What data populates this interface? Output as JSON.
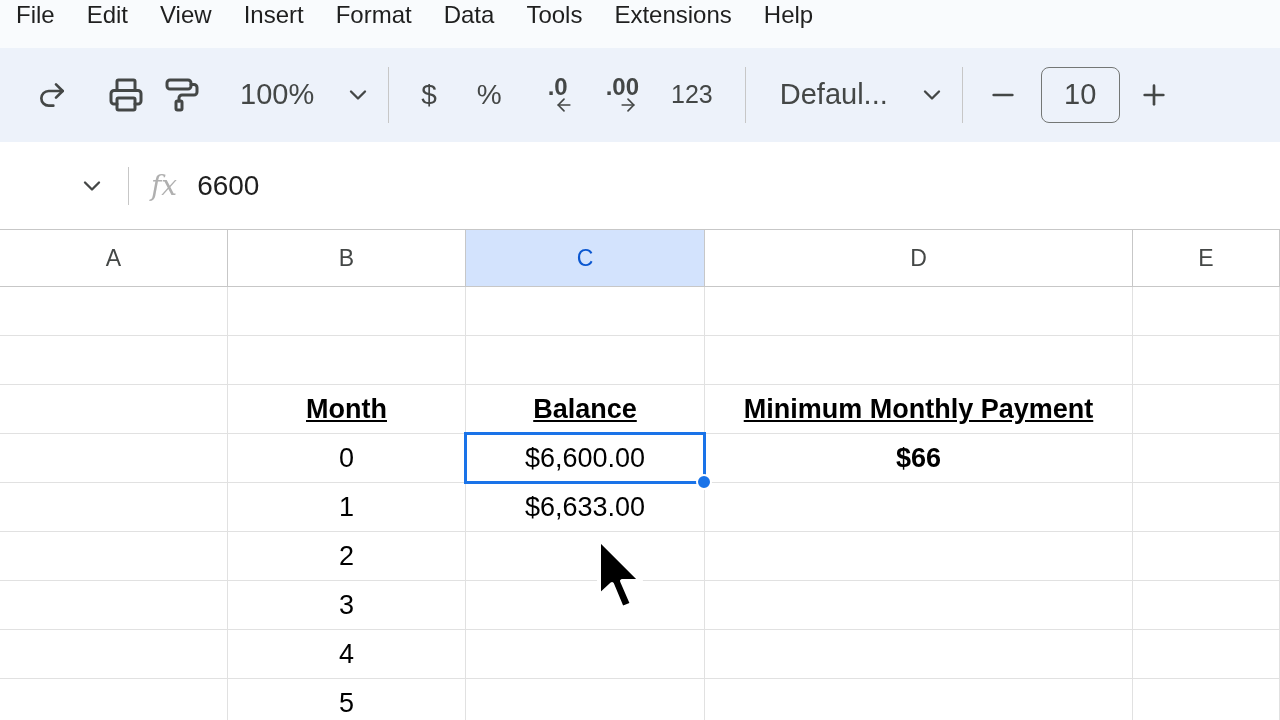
{
  "menu": [
    "File",
    "Edit",
    "View",
    "Insert",
    "Format",
    "Data",
    "Tools",
    "Extensions",
    "Help"
  ],
  "toolbar": {
    "zoom": "100%",
    "currency": "$",
    "percent": "%",
    "decrease_decimal": ".0",
    "increase_decimal": ".00",
    "number_format": "123",
    "font": "Defaul...",
    "font_size": "10"
  },
  "formula_bar": {
    "fx": "fx",
    "value": "6600"
  },
  "columns": [
    {
      "label": "A",
      "selected": false
    },
    {
      "label": "B",
      "selected": false
    },
    {
      "label": "C",
      "selected": true
    },
    {
      "label": "D",
      "selected": false
    },
    {
      "label": "E",
      "selected": false
    }
  ],
  "rows": [
    {},
    {},
    {
      "b": {
        "text": "Month",
        "bold": true,
        "underline": true,
        "selected": false
      },
      "c": {
        "text": "Balance",
        "bold": true,
        "underline": true,
        "selected": false
      },
      "d": {
        "text": "Minimum Monthly Payment",
        "bold": true,
        "underline": true,
        "selected": false
      }
    },
    {
      "b": {
        "text": "0",
        "bold": false,
        "underline": false,
        "selected": false
      },
      "c": {
        "text": "$6,600.00",
        "bold": false,
        "underline": false,
        "selected": true
      },
      "d": {
        "text": "$66",
        "bold": true,
        "underline": false,
        "selected": false
      }
    },
    {
      "b": {
        "text": "1",
        "bold": false,
        "underline": false,
        "selected": false
      },
      "c": {
        "text": "$6,633.00",
        "bold": false,
        "underline": false,
        "selected": false
      }
    },
    {
      "b": {
        "text": "2",
        "bold": false,
        "underline": false,
        "selected": false
      }
    },
    {
      "b": {
        "text": "3",
        "bold": false,
        "underline": false,
        "selected": false
      }
    },
    {
      "b": {
        "text": "4",
        "bold": false,
        "underline": false,
        "selected": false
      }
    },
    {
      "b": {
        "text": "5",
        "bold": false,
        "underline": false,
        "selected": false
      }
    }
  ]
}
